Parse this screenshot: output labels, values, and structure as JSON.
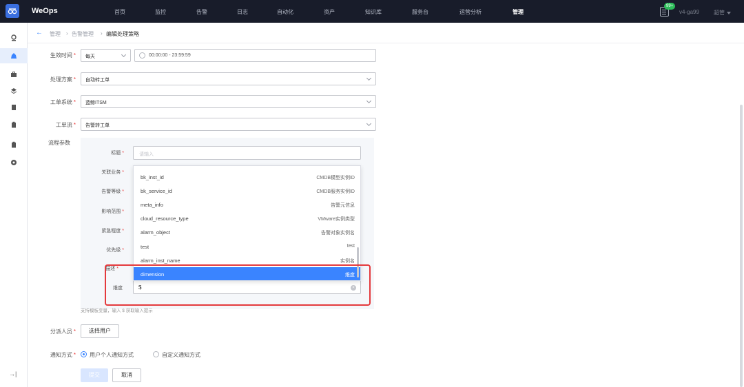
{
  "app": {
    "brand": "WeOps"
  },
  "nav": [
    "首页",
    "监控",
    "告警",
    "日志",
    "自动化",
    "资产",
    "知识库",
    "服务台",
    "运营分析",
    "管理"
  ],
  "header": {
    "badge": "99+",
    "user": "v4-ga99",
    "role": "超管"
  },
  "breadcrumb": {
    "items": [
      "管理",
      "告警管理"
    ],
    "current": "编辑处理策略"
  },
  "form": {
    "effective_time": {
      "label": "生效时间",
      "period": "每天",
      "range": "00:00:00 - 23:59:59"
    },
    "plan": {
      "label": "处理方案",
      "value": "自动转工单"
    },
    "ticket_system": {
      "label": "工单系统",
      "value": "蓝鲸ITSM"
    },
    "workflow": {
      "label": "工单流",
      "value": "告警转工单"
    },
    "params_label": "流程参数",
    "params": {
      "title": {
        "label": "标题",
        "placeholder": "请输入"
      },
      "labels": [
        "关联业务",
        "告警等级",
        "影响范围",
        "紧急程度",
        "优先级",
        "描述"
      ],
      "dimension": {
        "label": "维度",
        "value": "$"
      }
    },
    "hint": "支持模板变量，输入 $ 获取输入提示",
    "assignee": {
      "label": "分派人员",
      "button": "选择用户"
    },
    "notify": {
      "label": "通知方式",
      "options": [
        "用户个人通知方式",
        "自定义通知方式"
      ],
      "selected": 0
    },
    "actions": {
      "submit": "提交",
      "cancel": "取消"
    }
  },
  "dropdown": [
    {
      "key": "bk_inst_id",
      "desc": "CMDB模型实例ID"
    },
    {
      "key": "bk_service_id",
      "desc": "CMDB服务实例ID"
    },
    {
      "key": "meta_info",
      "desc": "告警元信息"
    },
    {
      "key": "cloud_resource_type",
      "desc": "VMware实例类型"
    },
    {
      "key": "alarm_object",
      "desc": "告警对象实例名"
    },
    {
      "key": "test",
      "desc": "test"
    },
    {
      "key": "alarm_inst_name",
      "desc": "实例名"
    },
    {
      "key": "dimension",
      "desc": "维度"
    }
  ],
  "colors": {
    "accent": "#3a84ff",
    "topbar": "#181c2a",
    "highlight": "#e4393c",
    "badge": "#2dbd5a"
  }
}
